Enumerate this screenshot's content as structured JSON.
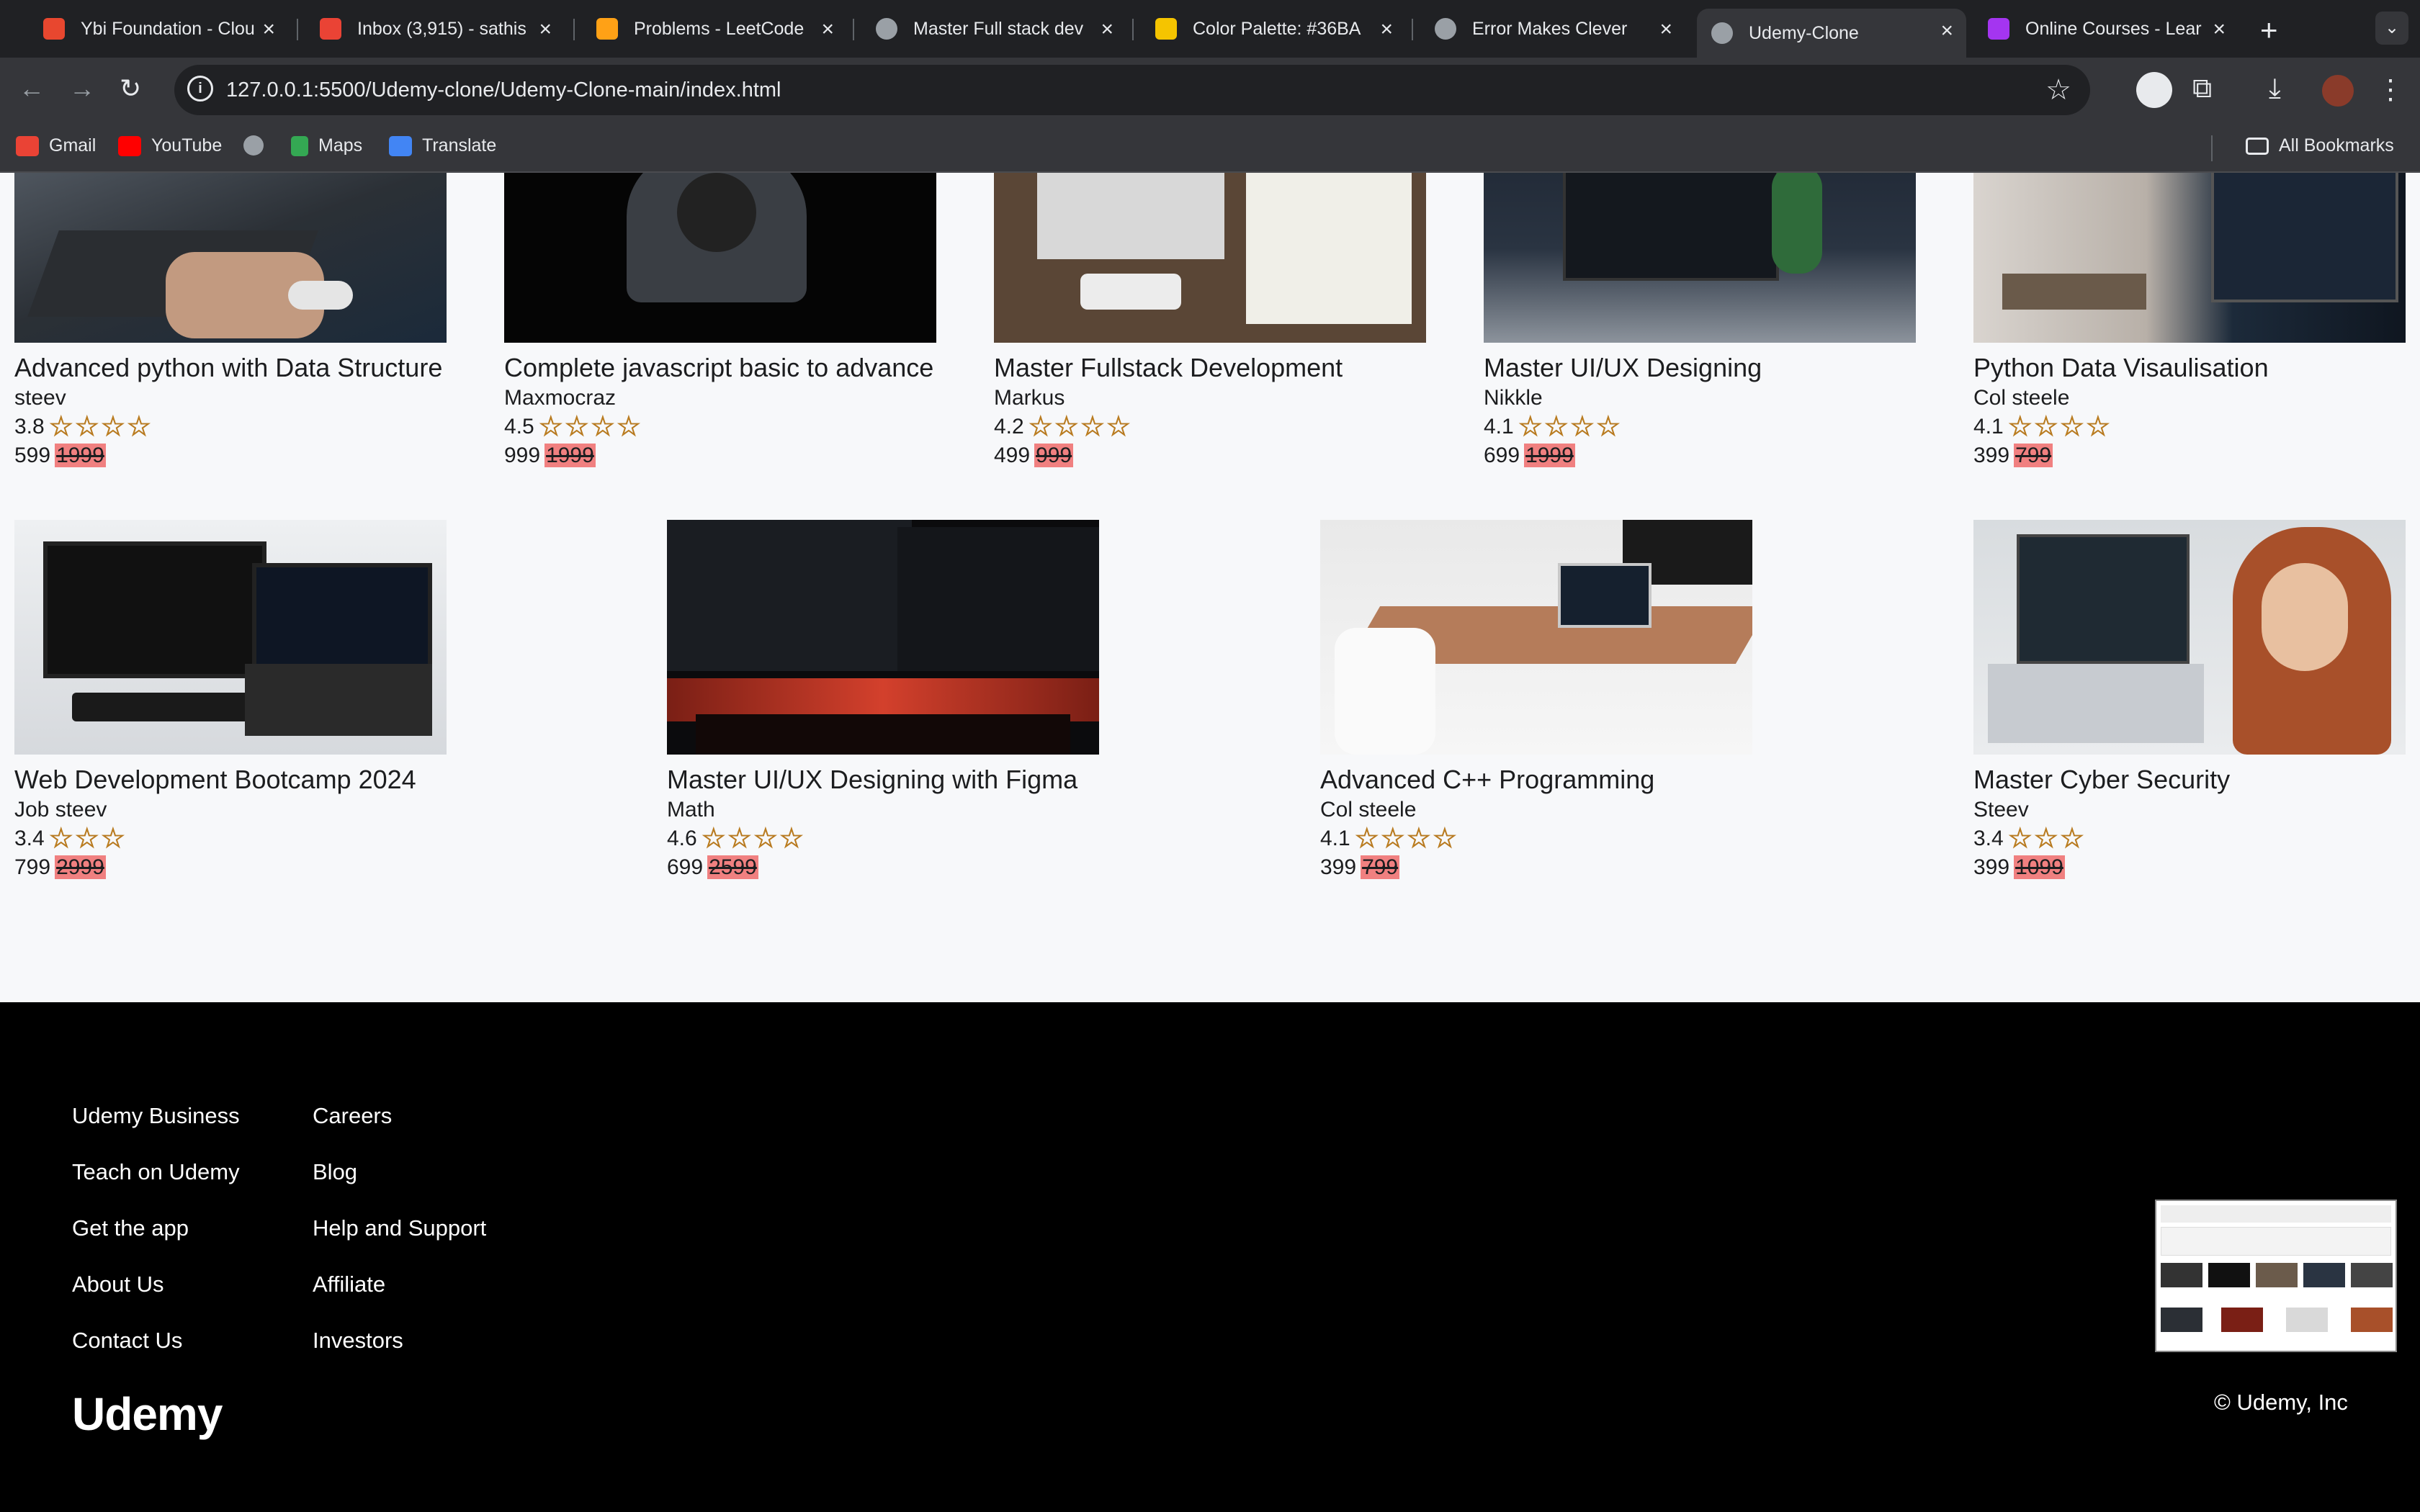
{
  "browser": {
    "tabs": [
      {
        "title": "Ybi Foundation - Clou",
        "color": "#e8472f"
      },
      {
        "title": "Inbox (3,915) - sathis",
        "color": "#ea4335"
      },
      {
        "title": "Problems - LeetCode",
        "color": "#ffa116"
      },
      {
        "title": "Master Full stack dev",
        "color": "#9aa0a6"
      },
      {
        "title": "Color Palette: #36BA",
        "color": "#f5c400"
      },
      {
        "title": "Error Makes Clever",
        "color": "#9aa0a6"
      },
      {
        "title": "Udemy-Clone",
        "color": "#9aa0a6"
      },
      {
        "title": "Online Courses - Lear",
        "color": "#a435f0"
      }
    ],
    "url": "127.0.0.1:5500/Udemy-clone/Udemy-Clone-main/index.html",
    "bookmarks": [
      {
        "label": "Gmail",
        "icon": "gmail-icon"
      },
      {
        "label": "YouTube",
        "icon": "youtube-icon"
      },
      {
        "label": "",
        "icon": "globe-icon"
      },
      {
        "label": "Maps",
        "icon": "maps-icon"
      },
      {
        "label": "Translate",
        "icon": "translate-icon"
      }
    ],
    "all_bookmarks": "All Bookmarks"
  },
  "courses_row1": [
    {
      "title": "Advanced python with Data Structure",
      "author": "steev",
      "rating": "3.8",
      "stars": "☆☆☆☆",
      "price": "599",
      "old_price": "1999"
    },
    {
      "title": "Complete javascript basic to advance",
      "author": "Maxmocraz",
      "rating": "4.5",
      "stars": "☆☆☆☆",
      "price": "999",
      "old_price": "1999"
    },
    {
      "title": "Master Fullstack Development",
      "author": "Markus",
      "rating": "4.2",
      "stars": "☆☆☆☆",
      "price": "499",
      "old_price": "999"
    },
    {
      "title": "Master UI/UX Designing",
      "author": "Nikkle",
      "rating": "4.1",
      "stars": "☆☆☆☆",
      "price": "699",
      "old_price": "1999"
    },
    {
      "title": "Python Data Visaulisation",
      "author": "Col steele",
      "rating": "4.1",
      "stars": "☆☆☆☆",
      "price": "399",
      "old_price": "799"
    }
  ],
  "courses_row2": [
    {
      "title": "Web Development Bootcamp 2024",
      "author": "Job steev",
      "rating": "3.4",
      "stars": "☆☆☆",
      "price": "799",
      "old_price": "2999"
    },
    {
      "title": "Master UI/UX Designing with Figma",
      "author": "Math",
      "rating": "4.6",
      "stars": "☆☆☆☆",
      "price": "699",
      "old_price": "2599"
    },
    {
      "title": "Advanced C++ Programming",
      "author": "Col steele",
      "rating": "4.1",
      "stars": "☆☆☆☆",
      "price": "399",
      "old_price": "799"
    },
    {
      "title": "Master Cyber Security",
      "author": "Steev",
      "rating": "3.4",
      "stars": "☆☆☆",
      "price": "399",
      "old_price": "1099"
    }
  ],
  "footer": {
    "col1": [
      "Udemy Business",
      "Teach on Udemy",
      "Get the app",
      "About Us",
      "Contact Us"
    ],
    "col2": [
      "Careers",
      "Blog",
      "Help and Support",
      "Affiliate",
      "Investors"
    ],
    "logo": "Udemy",
    "copyright": "© Udemy, Inc"
  }
}
